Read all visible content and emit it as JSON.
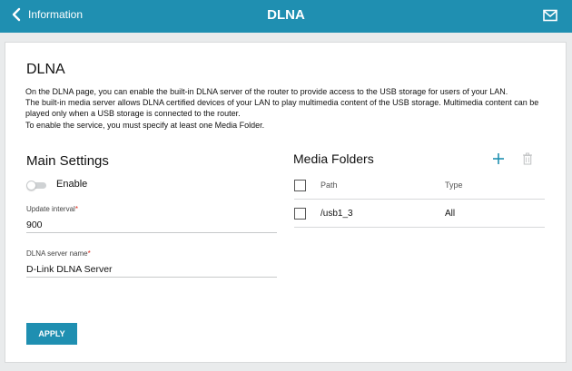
{
  "header": {
    "back_label": "Information",
    "title": "DLNA"
  },
  "page": {
    "title": "DLNA",
    "description": [
      "On the DLNA page, you can enable the built-in DLNA server of the router to provide access to the USB storage for users of your LAN.",
      "The built-in media server allows DLNA certified devices of your LAN to play multimedia content of the USB storage. Multimedia content can be played only when a USB storage is connected to the router.",
      "To enable the service, you must specify at least one Media Folder."
    ]
  },
  "main_settings": {
    "title": "Main Settings",
    "enable_label": "Enable",
    "enabled": false,
    "update_interval_label": "Update interval",
    "update_interval_value": "900",
    "server_name_label": "DLNA server name",
    "server_name_value": "D-Link DLNA Server",
    "required_mark": "*"
  },
  "media_folders": {
    "title": "Media Folders",
    "columns": [
      "Path",
      "Type"
    ],
    "rows": [
      {
        "path": "/usb1_3",
        "type": "All"
      }
    ]
  },
  "actions": {
    "apply_label": "APPLY"
  },
  "colors": {
    "accent": "#1f8fb1",
    "required": "#e0291b"
  }
}
